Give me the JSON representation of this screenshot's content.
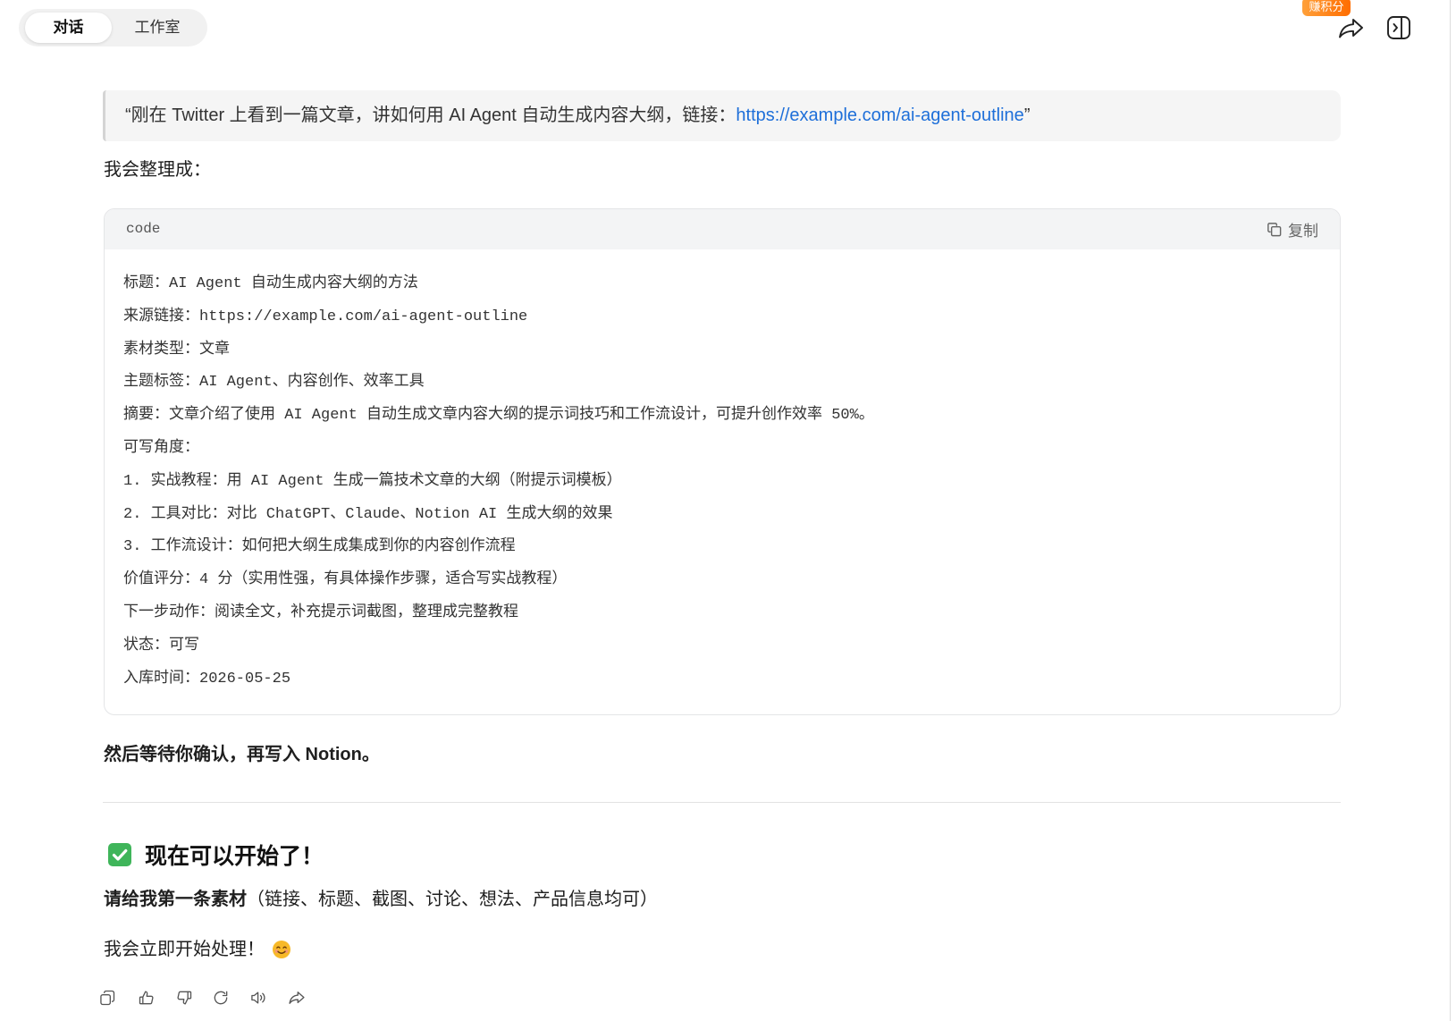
{
  "tabs": [
    {
      "label": "对话",
      "active": true
    },
    {
      "label": "工作室",
      "active": false
    }
  ],
  "header": {
    "points_badge": "赚积分",
    "icons": [
      "share-icon",
      "sidebar-toggle-icon"
    ]
  },
  "message": {
    "quote": {
      "text_before_link": "“刚在 Twitter 上看到一篇文章，讲如何用 AI Agent 自动生成内容大纲，链接：",
      "link": "https://example.com/ai-agent-outline",
      "text_after_link": "”"
    },
    "intro": "我会整理成：",
    "code_block": {
      "language_label": "code",
      "copy_icon": "copy-icon",
      "copy_label": "复制",
      "lines": [
        "标题：AI Agent 自动生成内容大纲的方法",
        "来源链接：https://example.com/ai-agent-outline",
        "素材类型：文章",
        "主题标签：AI Agent、内容创作、效率工具",
        "摘要：文章介绍了使用 AI Agent 自动生成文章内容大纲的提示词技巧和工作流设计，可提升创作效率 50%。",
        "可写角度：",
        "1. 实战教程：用 AI Agent 生成一篇技术文章的大纲（附提示词模板）",
        "2. 工具对比：对比 ChatGPT、Claude、Notion AI 生成大纲的效果",
        "3. 工作流设计：如何把大纲生成集成到你的内容创作流程",
        "价值评分：4 分（实用性强，有具体操作步骤，适合写实战教程）",
        "下一步动作：阅读全文，补充提示词截图，整理成完整教程",
        "状态：可写",
        "入库时间：2026-05-25"
      ]
    },
    "confirm_text": "然后等待你确认，再写入 Notion。",
    "section_heading": {
      "icon": "check-mark-button-emoji",
      "text": "现在可以开始了！"
    },
    "request": {
      "bold": "请给我第一条素材",
      "rest": "（链接、标题、截图、讨论、想法、产品信息均可）"
    },
    "closing": {
      "text": "我会立即开始处理！",
      "icon": "smiling-face-emoji"
    }
  },
  "message_actions": [
    "copy-icon",
    "thumbs-up-icon",
    "thumbs-down-icon",
    "regenerate-icon",
    "read-aloud-icon",
    "share-icon"
  ],
  "colors": {
    "link": "#1e6fd9",
    "badge": "#ff6d00",
    "text": "#1f1f1f",
    "check_emoji": "#3fb55a"
  }
}
